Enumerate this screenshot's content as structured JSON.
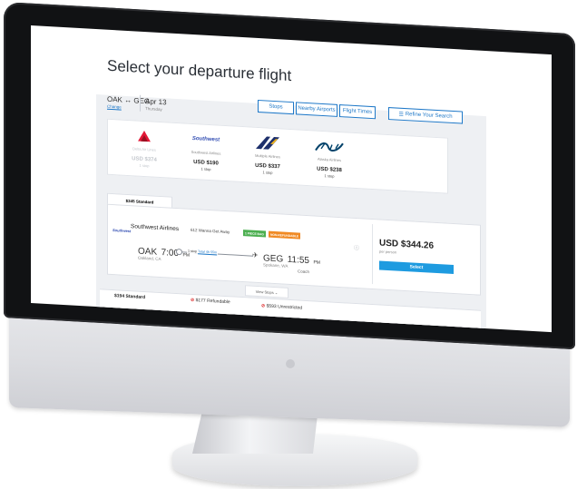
{
  "page": {
    "title": "Select your departure flight"
  },
  "search": {
    "route": "OAK ↔ GEG",
    "change_link": "Change",
    "date": "Apr 13",
    "day": "Thursday"
  },
  "filters": {
    "stops": "Stops",
    "nearby_airports": "Nearby Airports",
    "flight_times": "Flight Times",
    "refine": "Refine Your Search"
  },
  "airlines": [
    {
      "name": "Delta Air Lines",
      "price": "USD $374",
      "stops": "1 stop",
      "logo": "delta-triangle-icon",
      "faded": true
    },
    {
      "name": "Southwest Airlines",
      "price": "USD $190",
      "stops": "1 stop",
      "logo": "southwest-wordmark",
      "faded": false
    },
    {
      "name": "Multiple Airlines",
      "price": "USD $337",
      "stops": "1 stop",
      "logo": "multiple-airlines-icon",
      "faded": false
    },
    {
      "name": "Alaska Airlines",
      "price": "USD $238",
      "stops": "1 stop",
      "logo": "alaska-script-logo",
      "faded": false
    }
  ],
  "fare_tab": "$345 Standard",
  "result": {
    "airline_logo_text": "Southwest",
    "airline": "Southwest Airlines",
    "flight": "612 Wanna Get Away",
    "badges": [
      "1 PIECE BAG",
      "NON-REFUNDABLE"
    ],
    "info_icon": "info-icon",
    "depart_airport": "OAK",
    "depart_time": "7:00",
    "depart_period": "PM",
    "depart_city": "Oakland, CA",
    "stop_text": "1 stop",
    "total_time": "Total 4h 55m",
    "arrive_airport": "GEG",
    "arrive_time": "11:55",
    "arrive_period": "PM",
    "arrive_city": "Spokane, WA",
    "cabin": "Coach",
    "price": "USD $344.26",
    "per": "per person",
    "select": "Select",
    "view_stops": "View Stops ⌄"
  },
  "fare_tabs_bottom": [
    {
      "label": "$194 Standard",
      "excluded": false
    },
    {
      "label": "$177 Refundable",
      "excluded": true
    },
    {
      "label": "$593 Unrestricted",
      "excluded": true
    }
  ],
  "colors": {
    "accent": "#1e78c8",
    "select": "#1e9be0",
    "badge_green": "#4caf50",
    "badge_orange": "#f08a24",
    "delta_red": "#e31837",
    "southwest_blue": "#304cb2",
    "alaska_navy": "#01426a"
  }
}
